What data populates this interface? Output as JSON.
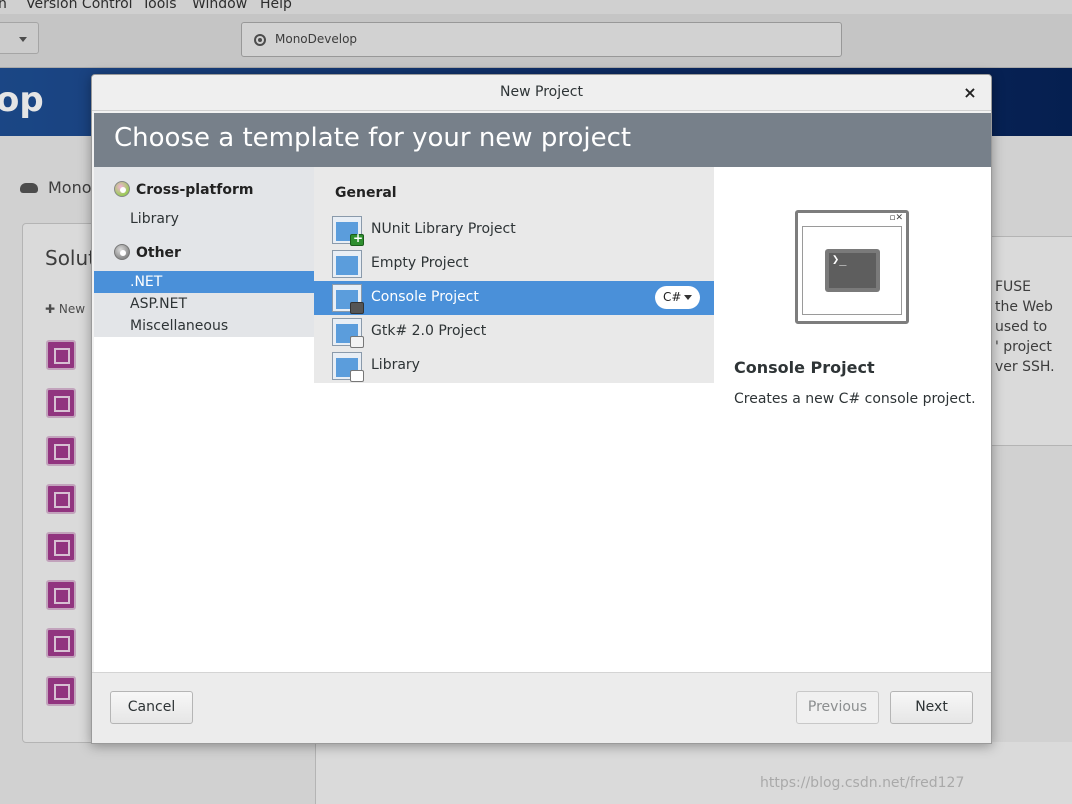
{
  "background": {
    "menubar": [
      "n",
      "Version Control",
      "Tools",
      "Window",
      "Help"
    ],
    "status_text": "MonoDevelop",
    "banner_text": "op",
    "breadcrumb": "MonoD",
    "panel_title": "Solut",
    "new_label": "New",
    "right_text": [
      "FUSE",
      "the Web",
      "used to",
      "' project",
      "ver SSH."
    ],
    "watermark": "https://blog.csdn.net/fred127"
  },
  "dialog": {
    "title": "New Project",
    "close_glyph": "×",
    "header": "Choose a template for your new project",
    "categories": {
      "groups": [
        {
          "label": "Cross-platform",
          "items": [
            "Library"
          ]
        },
        {
          "label": "Other",
          "items": [
            ".NET",
            "ASP.NET",
            "Miscellaneous"
          ]
        }
      ],
      "selected": ".NET"
    },
    "templates": {
      "group": "General",
      "items": [
        {
          "label": "NUnit Library Project",
          "icon": "nunit-project-icon"
        },
        {
          "label": "Empty Project",
          "icon": "empty-project-icon"
        },
        {
          "label": "Console Project",
          "icon": "console-project-icon",
          "language": "C#"
        },
        {
          "label": "Gtk# 2.0 Project",
          "icon": "gtk-project-icon"
        },
        {
          "label": "Library",
          "icon": "library-project-icon"
        }
      ],
      "selected": "Console Project"
    },
    "preview": {
      "terminal_glyph": "❯_",
      "name": "Console Project",
      "description": "Creates a new C# console project."
    },
    "buttons": {
      "cancel": "Cancel",
      "previous": "Previous",
      "next": "Next"
    }
  },
  "colors": {
    "selection": "#4a90d9",
    "header": "#77808a",
    "banner": "#0e2f6d",
    "nunit_badge": "#2f8f2f"
  }
}
